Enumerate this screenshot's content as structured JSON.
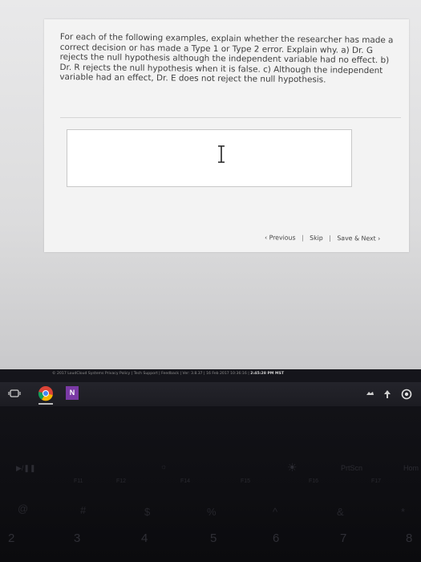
{
  "question": {
    "text": "For each of the following examples, explain whether the researcher has made a correct decision or has made a Type 1 or Type 2 error. Explain why. a) Dr. G rejects the null hypothesis although the independent variable had no effect. b) Dr. R rejects the null hypothesis when it is false. c) Although the independent variable had an effect, Dr. E does not reject the null hypothesis."
  },
  "answer_box": {
    "value": ""
  },
  "nav": {
    "previous": "‹ Previous",
    "separator": "|",
    "skip": "Skip",
    "save_next": "Save & Next ›"
  },
  "footer": {
    "copyright": "© 2017 LoudCloud Systems",
    "privacy": "Privacy Policy",
    "tech_support": "Tech Support",
    "feedback": "Feedback",
    "version": "Ver: 3.8.37",
    "date": "16 Feb 2017 10:36:16",
    "time": "2:45:28 PM MST",
    "sep": "|"
  },
  "taskbar": {
    "apps": [
      "window-switch-icon",
      "chrome-icon",
      "onenote-icon"
    ],
    "onenote_label": "N",
    "tray": [
      "cloud-icon",
      "network-icon",
      "status-icon"
    ]
  },
  "keyboard": {
    "fn_row": [
      "F11",
      "F12",
      "F13",
      "F14",
      "F15",
      "F16",
      "F17",
      "PrtScn",
      "Hom"
    ],
    "sym_row": [
      "@",
      "#",
      "$",
      "%",
      "^",
      "&",
      "*"
    ],
    "num_row": [
      "2",
      "3",
      "4",
      "5",
      "6",
      "7",
      "8"
    ]
  },
  "colors": {
    "page": "#f3f3f3",
    "text": "#3d3d3d",
    "keyboard": "#121217"
  }
}
